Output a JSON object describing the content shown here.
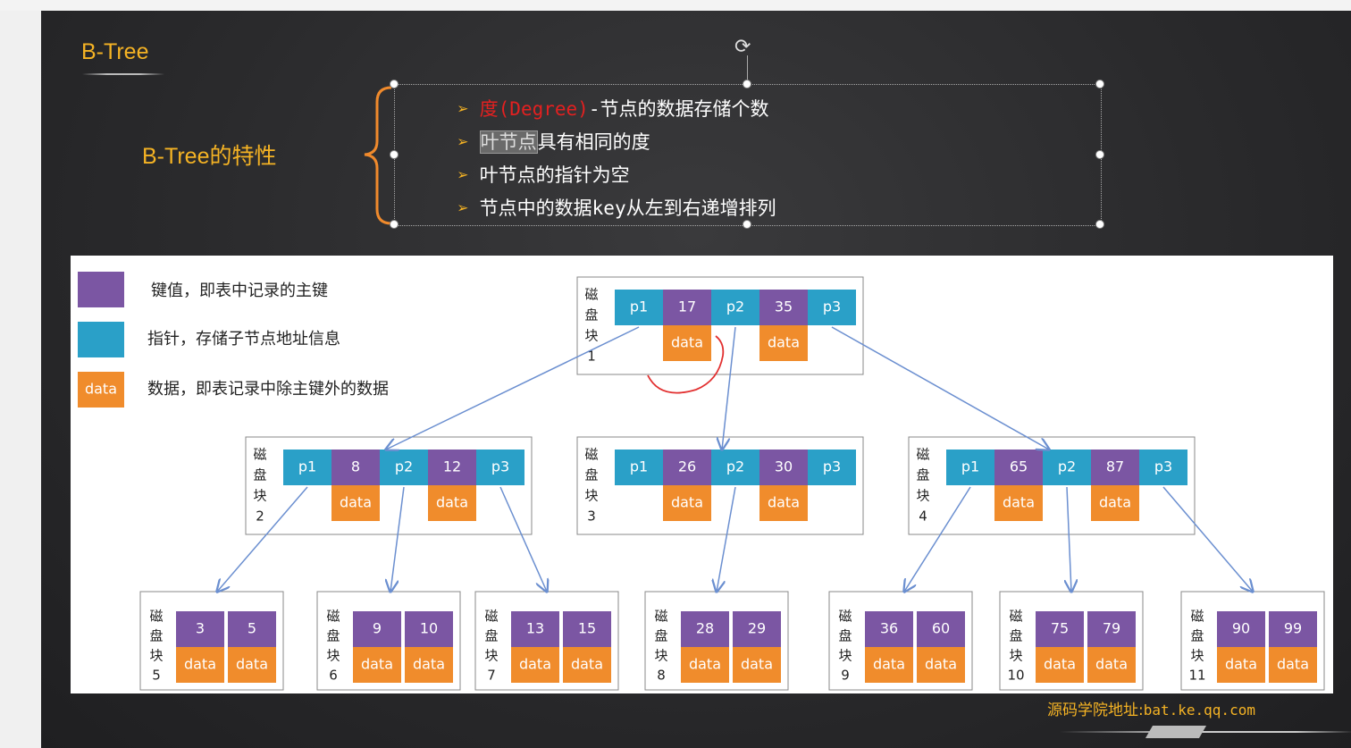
{
  "slide": {
    "title": "B-Tree",
    "subtitle": "B-Tree的特性",
    "bullets": [
      {
        "pre": "",
        "red": "度(Degree)",
        "post": "-节点的数据存储个数",
        "hl": ""
      },
      {
        "pre": "",
        "red": "",
        "post": "具有相同的度",
        "hl": "叶节点"
      },
      {
        "pre": "叶节点的指针为空",
        "red": "",
        "post": "",
        "hl": ""
      },
      {
        "pre": "节点中的数据key从左到右递增排列",
        "red": "",
        "post": "",
        "hl": ""
      }
    ],
    "footer_cn": "源码学院地址:",
    "footer_url": "bat.ke.qq.com"
  },
  "legend": [
    {
      "type": "key",
      "text": "键值，即表中记录的主键"
    },
    {
      "type": "ptr",
      "text": "指针，存储子节点地址信息"
    },
    {
      "type": "data",
      "label": "data",
      "text": "数据，即表记录中除主键外的数据"
    }
  ],
  "colors": {
    "key": "#7b56a3",
    "ptr": "#2aa0c8",
    "data": "#f08c2c",
    "accent": "#f5b324",
    "arrow": "#6b8fd0"
  },
  "block_label": "磁盘块",
  "tree": {
    "root": {
      "num": "1",
      "ptrs": [
        "p1",
        "p2",
        "p3"
      ],
      "keys": [
        "17",
        "35"
      ],
      "data": [
        "data",
        "data"
      ]
    },
    "level2": [
      {
        "num": "2",
        "ptrs": [
          "p1",
          "p2",
          "p3"
        ],
        "keys": [
          "8",
          "12"
        ],
        "data": [
          "data",
          "data"
        ]
      },
      {
        "num": "3",
        "ptrs": [
          "p1",
          "p2",
          "p3"
        ],
        "keys": [
          "26",
          "30"
        ],
        "data": [
          "data",
          "data"
        ]
      },
      {
        "num": "4",
        "ptrs": [
          "p1",
          "p2",
          "p3"
        ],
        "keys": [
          "65",
          "87"
        ],
        "data": [
          "data",
          "data"
        ]
      }
    ],
    "leaves": [
      {
        "num": "5",
        "keys": [
          "3",
          "5"
        ],
        "data": [
          "data",
          "data"
        ]
      },
      {
        "num": "6",
        "keys": [
          "9",
          "10"
        ],
        "data": [
          "data",
          "data"
        ]
      },
      {
        "num": "7",
        "keys": [
          "13",
          "15"
        ],
        "data": [
          "data",
          "data"
        ]
      },
      {
        "num": "8",
        "keys": [
          "28",
          "29"
        ],
        "data": [
          "data",
          "data"
        ]
      },
      {
        "num": "9",
        "keys": [
          "36",
          "60"
        ],
        "data": [
          "data",
          "data"
        ]
      },
      {
        "num": "10",
        "keys": [
          "75",
          "79"
        ],
        "data": [
          "data",
          "data"
        ]
      },
      {
        "num": "11",
        "keys": [
          "90",
          "99"
        ],
        "data": [
          "data",
          "data"
        ]
      }
    ]
  }
}
